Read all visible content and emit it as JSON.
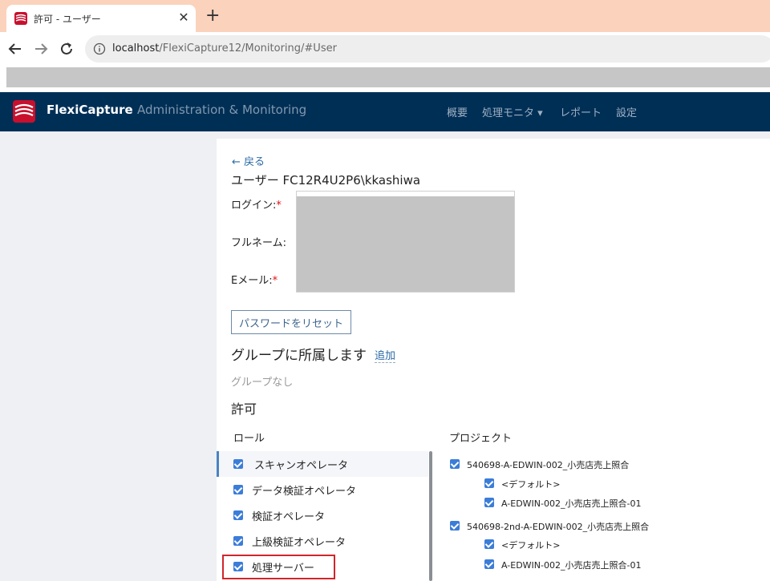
{
  "browser": {
    "tab_title": "許可 - ユーザー",
    "tab_close": "✕",
    "new_tab": "+",
    "url_host": "localhost",
    "url_path": "/FlexiCapture12/Monitoring/#User"
  },
  "app": {
    "name": "FlexiCapture",
    "section": "Administration & Monitoring",
    "nav": [
      "概要",
      "処理モニタ ▾",
      "レポート",
      "設定"
    ]
  },
  "user": {
    "back": "← 戻る",
    "title": "ユーザー FC12R4U2P6\\kkashiwa",
    "login_label": "ログイン:",
    "fullname_label": "フルネーム:",
    "email_label": "Eメール:",
    "required_mark": "*",
    "reset_password": "パスワードをリセット"
  },
  "groups": {
    "heading": "グループに所属します",
    "add": "追加",
    "empty": "グループなし"
  },
  "permissions": {
    "heading": "許可",
    "roles_header": "ロール",
    "projects_header": "プロジェクト",
    "roles": [
      {
        "label": "スキャンオペレータ",
        "checked": true
      },
      {
        "label": "データ検証オペレータ",
        "checked": true
      },
      {
        "label": "検証オペレータ",
        "checked": true
      },
      {
        "label": "上級検証オペレータ",
        "checked": true
      },
      {
        "label": "処理サーバー",
        "checked": true
      }
    ],
    "projects": [
      {
        "label": "540698-A-EDWIN-002_小売店売上照合",
        "checked": true
      },
      {
        "label": "<デフォルト>",
        "checked": true
      },
      {
        "label": "A-EDWIN-002_小売店売上照合-01",
        "checked": true
      },
      {
        "label": "540698-2nd-A-EDWIN-002_小売店売上照合",
        "checked": true
      },
      {
        "label": "<デフォルト>",
        "checked": true
      },
      {
        "label": "A-EDWIN-002_小売店売上照合-01",
        "checked": true
      }
    ]
  },
  "colors": {
    "appbar": "#002f56",
    "accent": "#3b7dd8",
    "highlight": "#d0262a"
  }
}
